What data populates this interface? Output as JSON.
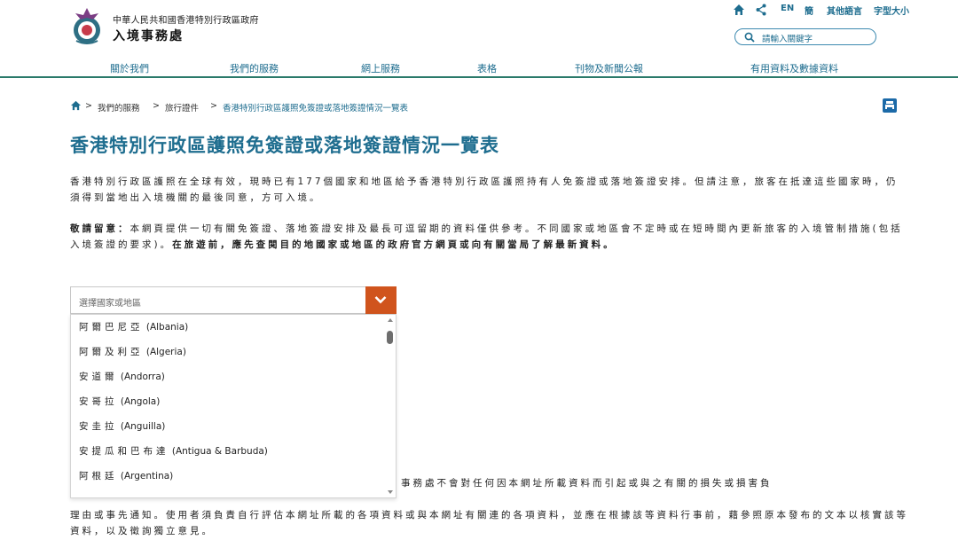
{
  "header": {
    "org_sub": "中華人民共和國香港特別行政區政府",
    "org_main": "入境事務處",
    "utility": {
      "home_icon": "home-icon",
      "share_icon": "share-icon",
      "lang_en": "EN",
      "lang_sc": "簡",
      "other_lang": "其他語言",
      "font_size": "字型大小"
    },
    "search": {
      "placeholder": "請輸入關鍵字",
      "icon": "search-icon"
    },
    "nav": [
      "關於我們",
      "我們的服務",
      "網上服務",
      "表格",
      "刊物及新聞公報",
      "有用資料及數據資料"
    ]
  },
  "breadcrumb": {
    "home_icon": "home-icon",
    "sep": ">",
    "items": [
      "我們的服務",
      "旅行證件"
    ],
    "current": "香港特別行政區護照免簽證或落地簽證情況一覽表"
  },
  "page": {
    "print_icon": "print-icon",
    "title": "香港特別行政區護照免簽證或落地簽證情況一覽表",
    "para1": "香港特別行政區護照在全球有效，現時已有177個國家和地區給予香港特別行政區護照持有人免簽證或落地簽證安排。但請注意，旅客在抵達這些國家時，仍須得到當地出入境機關的最後同意，方可入境。",
    "para2_lead": "敬請留意：",
    "para2_normal": "本網頁提供一切有關免簽證、落地簽證安排及最長可逗留期的資料僅供參考。不同國家或地區會不定時或在短時間內更新旅客的入境管制措施(包括入境簽證的要求)。",
    "para2_bold": "在旅遊前，應先查閱目的地國家或地區的政府官方網頁或向有關當局了解最新資料。",
    "para3": "事務處不會對任何因本網址所載資料而引起或與之有關的損失或損害負",
    "para4": "理由或事先通知。使用者須負責自行評估本網址所載的各項資料或與本網址有關連的各項資料，並應在根據該等資料行事前，藉參照原本發布的文本以核實該等資料，以及徵詢獨立意見。"
  },
  "select": {
    "placeholder": "選擇國家或地區",
    "button_icon": "chevron-down-icon",
    "accent_color": "#d0541d",
    "options": [
      {
        "zh": "阿爾巴尼亞",
        "en": "(Albania)"
      },
      {
        "zh": "阿爾及利亞",
        "en": "(Algeria)"
      },
      {
        "zh": "安道爾",
        "en": "(Andorra)"
      },
      {
        "zh": "安哥拉",
        "en": "(Angola)"
      },
      {
        "zh": "安圭拉",
        "en": "(Anguilla)"
      },
      {
        "zh": "安提瓜和巴布達",
        "en": "(Antigua & Barbuda)"
      },
      {
        "zh": "阿根廷",
        "en": "(Argentina)"
      }
    ]
  },
  "colors": {
    "brand_teal": "#1e6d8f",
    "nav_rule": "#2a7a6a",
    "print_blue": "#1c6aa8"
  }
}
